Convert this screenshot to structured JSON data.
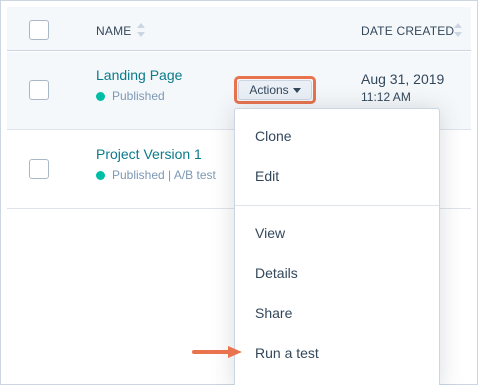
{
  "table": {
    "columns": {
      "name": "NAME",
      "date_created": "DATE CREATED"
    },
    "rows": [
      {
        "name": "Landing Page",
        "status": "Published",
        "date": "Aug 31, 2019",
        "time": "11:12 AM",
        "actions_label": "Actions"
      },
      {
        "name": "Project Version 1",
        "status": "Published | A/B test"
      }
    ]
  },
  "menu": {
    "items": [
      "Clone",
      "Edit",
      "View",
      "Details",
      "Share",
      "Run a test"
    ]
  },
  "colors": {
    "accent": "#e8734e",
    "link": "#0b7a8c",
    "status_published": "#00bda5"
  },
  "icons": {
    "sort": "sort-icon",
    "caret": "caret-down-icon",
    "arrow": "arrow-right-icon"
  }
}
